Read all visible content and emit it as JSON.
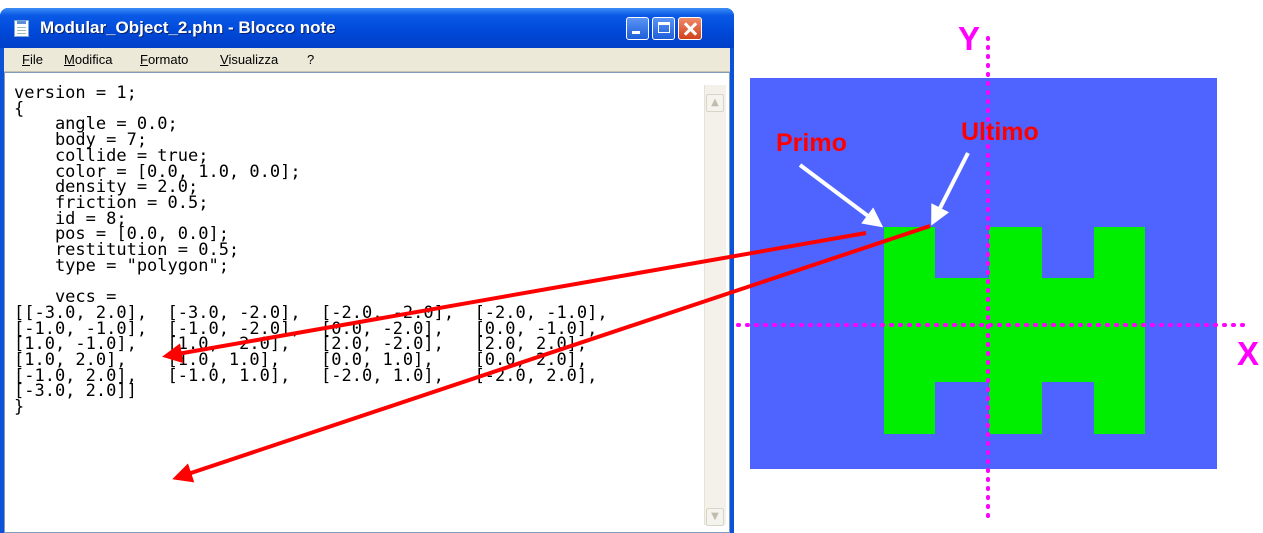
{
  "window": {
    "title": "Modular_Object_2.phn - Blocco note",
    "menu": [
      "File",
      "Modifica",
      "Formato",
      "Visualizza",
      "?"
    ]
  },
  "editor": {
    "text": "version = 1;\n{\n    angle = 0.0;\n    body = 7;\n    collide = true;\n    color = [0.0, 1.0, 0.0];\n    density = 2.0;\n    friction = 0.5;\n    id = 8;\n    pos = [0.0, 0.0];\n    restitution = 0.5;\n    type = \"polygon\";\n\n    vecs =\n[[-3.0, 2.0],  [-3.0, -2.0],  [-2.0, -2.0],  [-2.0, -1.0],\n[-1.0, -1.0],  [-1.0, -2.0],  [0.0, -2.0],   [0.0, -1.0],\n[1.0, -1.0],   [1.0, -2.0],   [2.0, -2.0],   [2.0, 2.0],\n[1.0, 2.0],    [1.0, 1.0],    [0.0, 1.0],    [0.0, 2.0],\n[-1.0, 2.0],   [-1.0, 1.0],   [-2.0, 1.0],   [-2.0, 2.0],\n[-3.0, 2.0]]\n}"
  },
  "diagram": {
    "labels": {
      "primo": "Primo",
      "ultimo": "Ultimo",
      "y_axis": "Y",
      "x_axis": "X"
    },
    "colors": {
      "background": "#4f64ff",
      "shape": "#00ee00",
      "axes": "#ff00ff",
      "arrows": "#ff0000",
      "pointer": "#ffffff"
    }
  }
}
